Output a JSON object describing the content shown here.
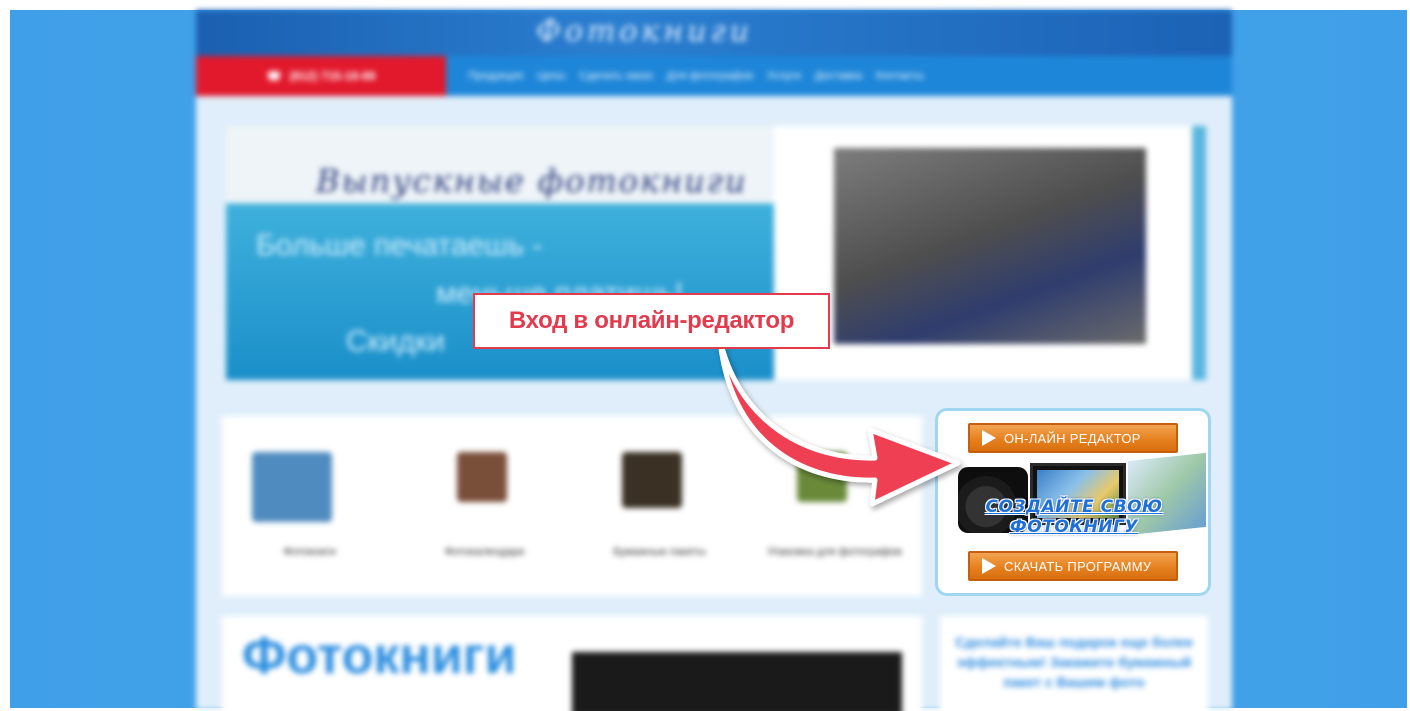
{
  "site": {
    "banner_title": "Фотокниги",
    "nav": {
      "phone": "(812) 715-18-88",
      "items": [
        "Продукция",
        "Цены",
        "Сделать заказ",
        "Для фотографов",
        "Услуги",
        "Доставка",
        "Контакты"
      ]
    },
    "hero": {
      "title": "Выпускные фотокниги",
      "subtitle_line1": "Больше печатаешь -",
      "subtitle_line2": "меньше платишь!",
      "subtitle_line3": "Скидки"
    },
    "tiles": [
      {
        "label": "Фотокниги"
      },
      {
        "label": "Фотокалендари"
      },
      {
        "label": "Бумажные пакеты"
      },
      {
        "label": "Упаковка для фотографов"
      }
    ],
    "bottom": {
      "title": "Фотокниги",
      "promo_text": "Сделайте Ваш подарок еще более эффектным! Закажите бумажный пакет с Вашим фото"
    }
  },
  "widget": {
    "online_editor_label": "ОН-ЛАЙН РЕДАКТОР",
    "promo_text": "СОЗДАЙТЕ СВОЮ ФОТОКНИГУ",
    "download_label": "СКАЧАТЬ ПРОГРАММУ"
  },
  "annotation": {
    "callout_text": "Вход в онлайн-редактор",
    "color": "#e23b4e"
  },
  "colors": {
    "background": "#3a9ae6",
    "button_orange": "#e6811f",
    "nav_red": "#e2182c",
    "nav_blue": "#1e86d8"
  }
}
